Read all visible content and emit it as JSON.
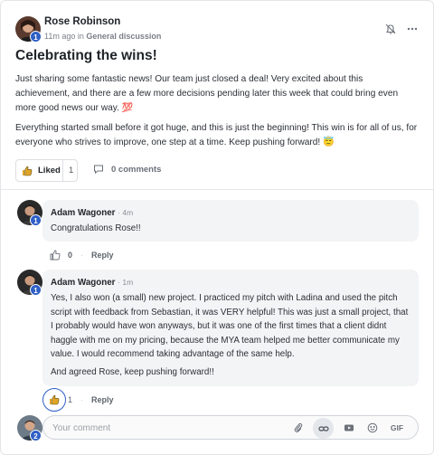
{
  "post": {
    "author": "Rose Robinson",
    "author_level": "1",
    "time": "11m ago in ",
    "category": "General discussion",
    "title": "Celebrating the wins!",
    "paragraph1": "Just sharing some fantastic news! Our team just closed a deal! Very excited about this achievement, and there are a few more decisions pending later this week that could bring even more good news our way. 💯",
    "paragraph2": "Everything started small before it got huge, and this is just the beginning! This win is for all of us, for everyone who strives to improve, one step at a time. Keep pushing forward! 😇",
    "liked_label": "Liked",
    "like_count": "1",
    "comments_label": "0 comments"
  },
  "comments": [
    {
      "author": "Adam Wagoner",
      "time": "· 4m",
      "level": "1",
      "text": "Congratulations Rose!!",
      "like_count": "0",
      "reply_label": "Reply"
    },
    {
      "author": "Adam Wagoner",
      "time": "· 1m",
      "level": "1",
      "text": "Yes, I also won (a small) new project. I practiced my pitch with Ladina and used the pitch script with feedback from Sebastian, it was VERY helpful! This was just a small project, that I probably would have won anyways, but it was one of the first times that a client didnt haggle with me on my pricing, because the MYA team helped me better communicate my value. I would recommend taking advantage of the same help.",
      "text2": "And agreed Rose, keep pushing forward!!",
      "like_count": "1",
      "reply_label": "Reply"
    }
  ],
  "composer": {
    "placeholder": "Your comment",
    "user_level": "2",
    "gif_label": "GIF"
  },
  "colors": {
    "accent": "#2f5fc6",
    "like_icon": "#e0a526"
  },
  "icons": [
    "bell-off-icon",
    "more-icon",
    "thumbs-up-icon",
    "comment-icon",
    "paperclip-icon",
    "link-icon",
    "video-icon",
    "emoji-icon"
  ]
}
